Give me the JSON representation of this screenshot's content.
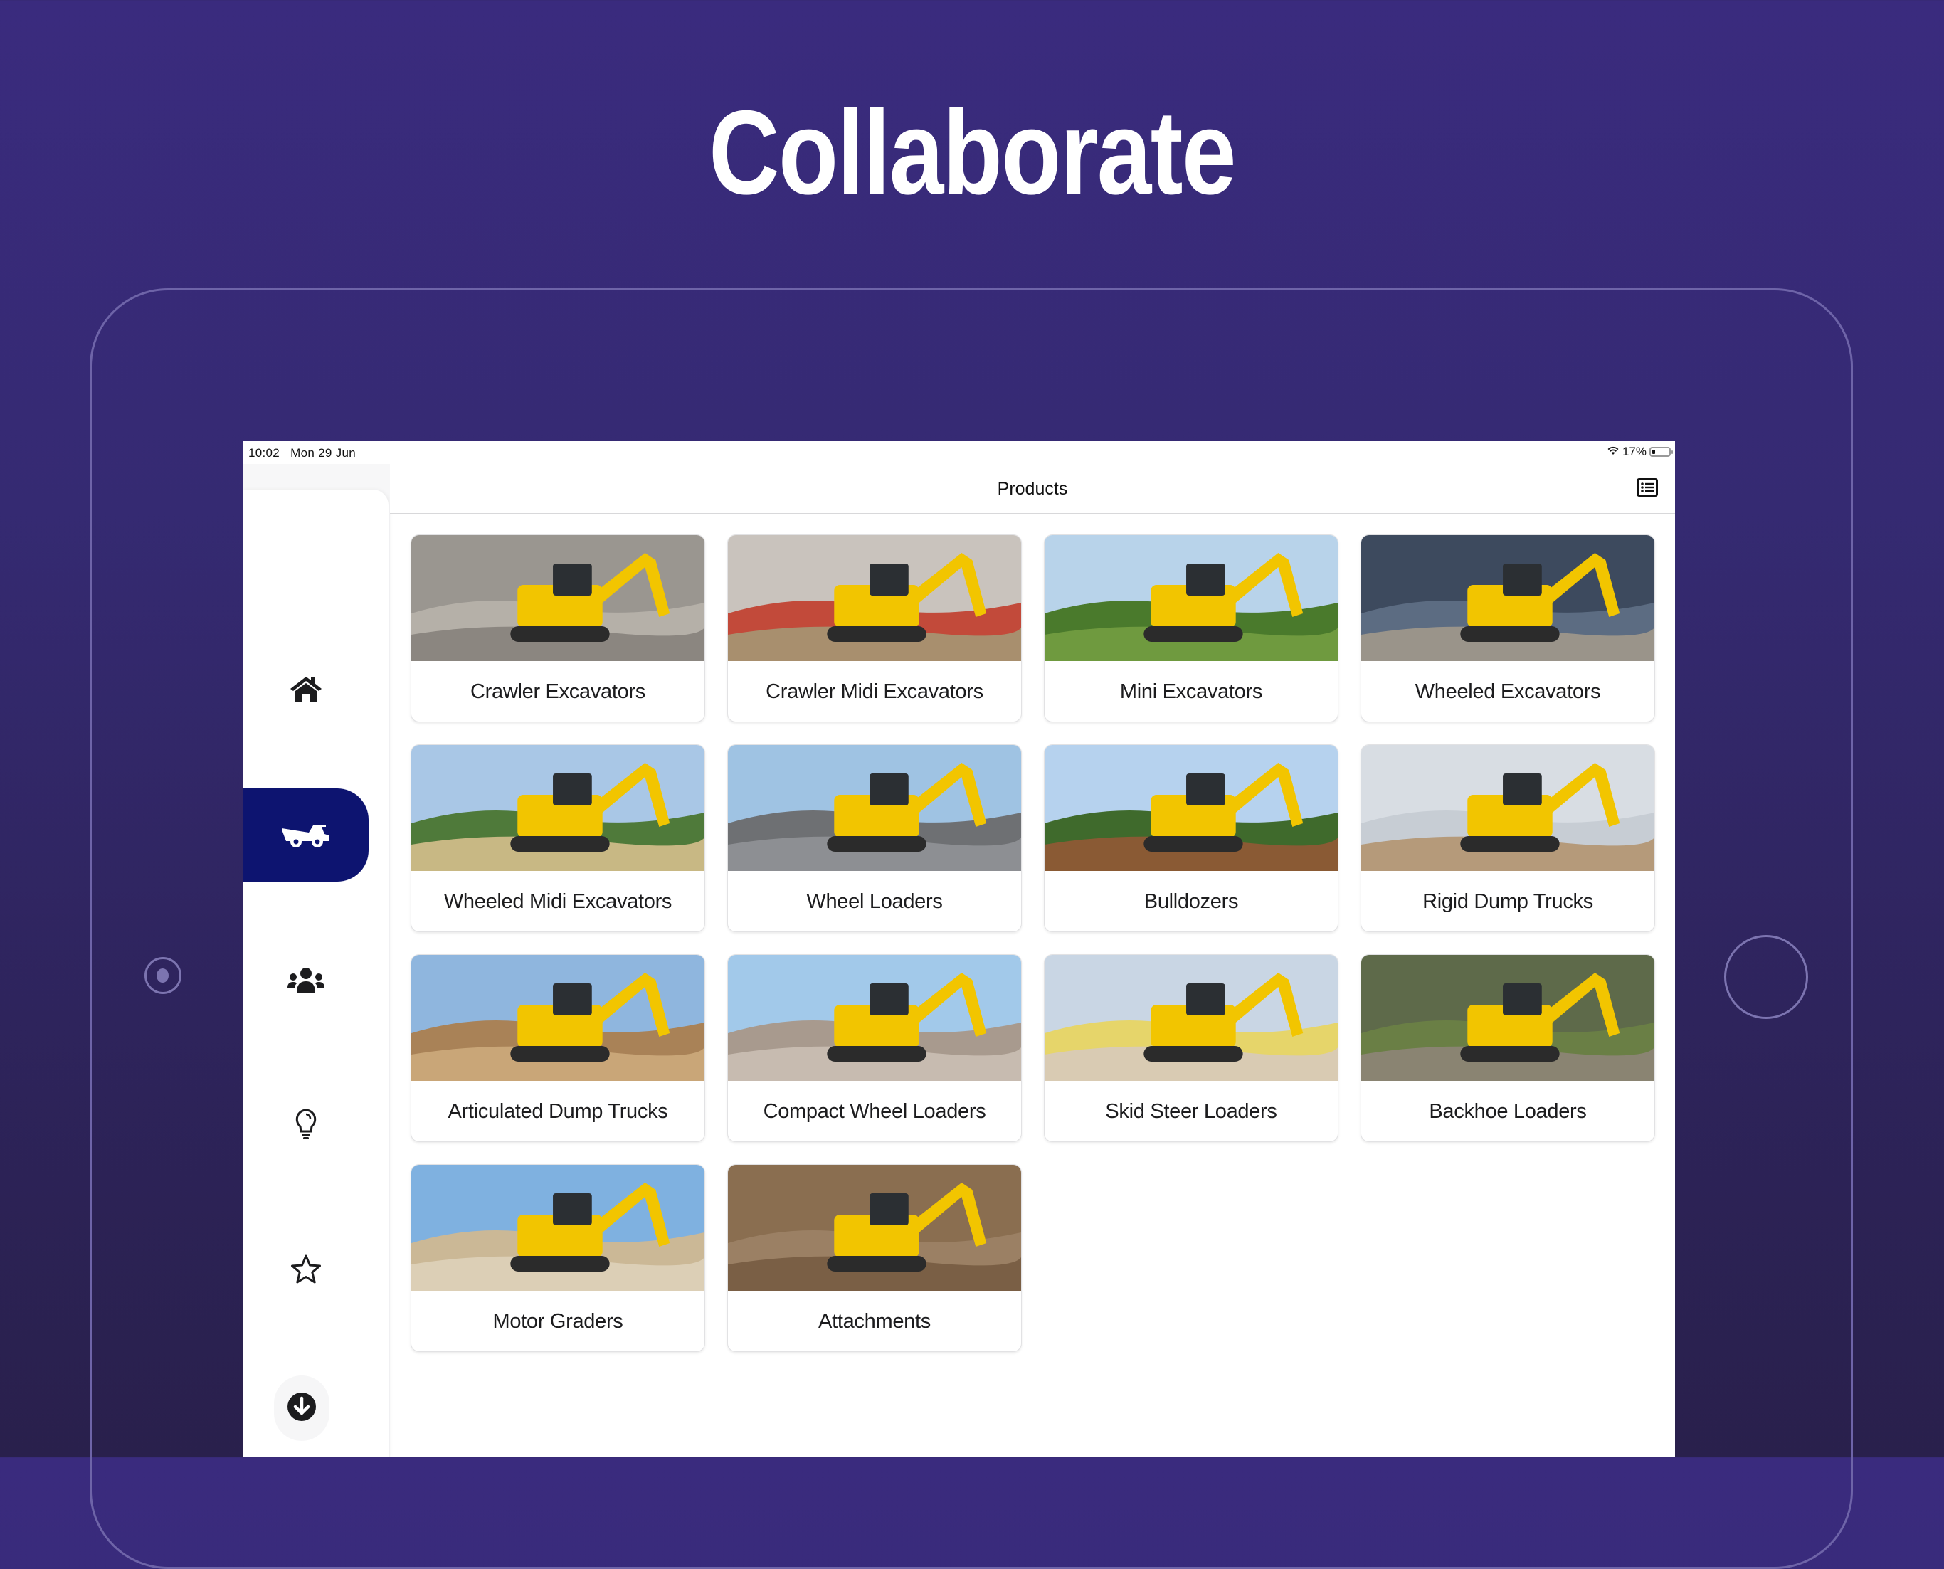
{
  "hero": {
    "title": "Collaborate"
  },
  "status_bar": {
    "time": "10:02",
    "date": "Mon 29 Jun",
    "battery_percent": "17%",
    "battery_level": 0.17,
    "wifi_icon": "wifi-icon"
  },
  "header": {
    "title": "Products",
    "right_icon": "list-view-icon"
  },
  "sidebar": {
    "items": [
      {
        "id": "home",
        "icon": "home-icon",
        "active": false
      },
      {
        "id": "products",
        "icon": "dump-truck-icon",
        "active": true
      },
      {
        "id": "team",
        "icon": "users-icon",
        "active": false
      },
      {
        "id": "ideas",
        "icon": "lightbulb-icon",
        "active": false
      },
      {
        "id": "favourites",
        "icon": "star-icon",
        "active": false
      }
    ],
    "bottom_button": {
      "icon": "download-circle-icon"
    }
  },
  "colors": {
    "accent": "#0d1470",
    "background_top": "#3a2b7e",
    "background_bottom": "#29204c",
    "machine_yellow": "#f2c500"
  },
  "products": [
    {
      "label": "Crawler Excavators",
      "scene": "rock"
    },
    {
      "label": "Crawler Midi Excavators",
      "scene": "site"
    },
    {
      "label": "Mini Excavators",
      "scene": "grass"
    },
    {
      "label": "Wheeled Excavators",
      "scene": "building"
    },
    {
      "label": "Wheeled Midi Excavators",
      "scene": "hills"
    },
    {
      "label": "Wheel Loaders",
      "scene": "gravel"
    },
    {
      "label": "Bulldozers",
      "scene": "dirt"
    },
    {
      "label": "Rigid Dump Trucks",
      "scene": "cloudy"
    },
    {
      "label": "Articulated Dump Trucks",
      "scene": "quarry"
    },
    {
      "label": "Compact Wheel Loaders",
      "scene": "gravel-sky"
    },
    {
      "label": "Skid Steer Loaders",
      "scene": "sand"
    },
    {
      "label": "Backhoe Loaders",
      "scene": "road"
    },
    {
      "label": "Motor Graders",
      "scene": "desert"
    },
    {
      "label": "Attachments",
      "scene": "earth"
    }
  ]
}
